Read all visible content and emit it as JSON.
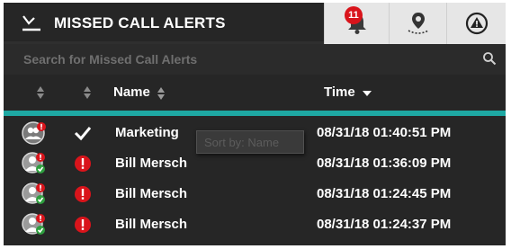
{
  "header": {
    "title": "MISSED CALL ALERTS",
    "bell_badge": "11"
  },
  "search": {
    "placeholder": "Search for Missed Call Alerts",
    "value": ""
  },
  "columns": {
    "name": "Name",
    "time": "Time",
    "time_sort": "descending"
  },
  "tooltip": "Sort by: Name",
  "rows": [
    {
      "avatar": "group-avatar-alert",
      "status": "checkmark-icon",
      "name": "Marketing",
      "time": "08/31/18 01:40:51 PM"
    },
    {
      "avatar": "user-avatar-check",
      "status": "alert-red-icon",
      "name": "Bill Mersch",
      "time": "08/31/18 01:36:09 PM"
    },
    {
      "avatar": "user-avatar-check",
      "status": "alert-red-icon",
      "name": "Bill Mersch",
      "time": "08/31/18 01:24:45 PM"
    },
    {
      "avatar": "user-avatar-check",
      "status": "alert-red-icon",
      "name": "Bill Mersch",
      "time": "08/31/18 01:24:37 PM"
    }
  ],
  "colors": {
    "background": "#262626",
    "accent_teal": "#1ea8a3",
    "alert_red": "#d9141b",
    "check_green": "#2e9e3e"
  }
}
